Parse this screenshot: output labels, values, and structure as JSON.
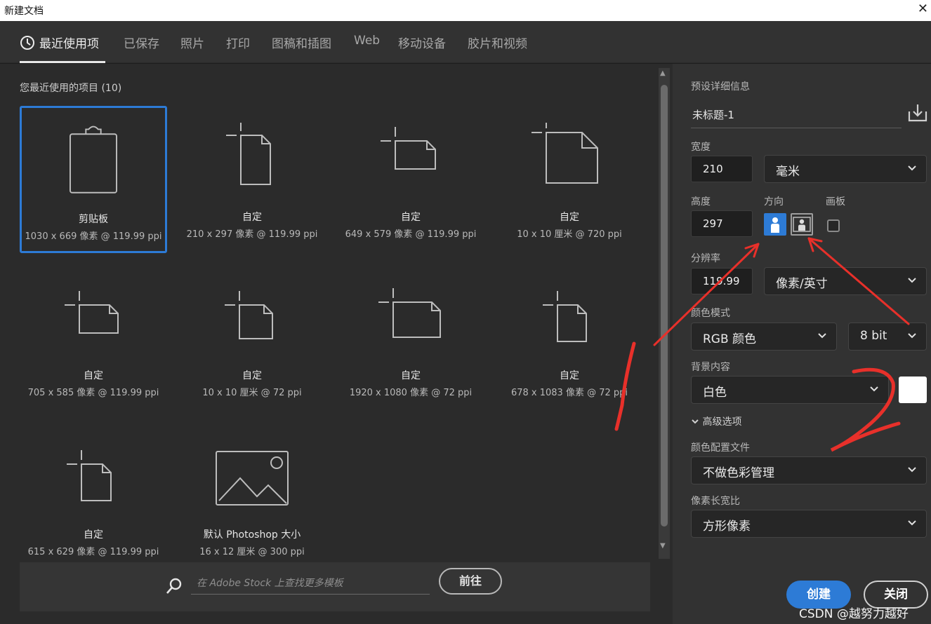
{
  "window": {
    "title": "新建文档",
    "close_glyph": "✕"
  },
  "tabs": [
    {
      "label": "最近使用项",
      "active": true
    },
    {
      "label": "已保存"
    },
    {
      "label": "照片"
    },
    {
      "label": "打印"
    },
    {
      "label": "图稿和插图"
    },
    {
      "label": "Web"
    },
    {
      "label": "移动设备"
    },
    {
      "label": "胶片和视频"
    }
  ],
  "recent": {
    "title": "您最近使用的项目",
    "count": "(10)",
    "items": [
      {
        "name": "剪贴板",
        "meta": "1030 x 669 像素 @ 119.99 ppi",
        "icon": "clipboard-icon",
        "selected": true
      },
      {
        "name": "自定",
        "meta": "210 x 297 像素 @ 119.99 ppi",
        "icon": "portrait-doc-icon"
      },
      {
        "name": "自定",
        "meta": "649 x 579 像素 @ 119.99 ppi",
        "icon": "landscape-doc-icon"
      },
      {
        "name": "自定",
        "meta": "10 x 10 厘米 @ 720 ppi",
        "icon": "square-doc-icon"
      },
      {
        "name": "自定",
        "meta": "705 x 585 像素 @ 119.99 ppi",
        "icon": "landscape-doc-icon"
      },
      {
        "name": "自定",
        "meta": "10 x 10 厘米 @ 72 ppi",
        "icon": "portrait-doc-icon"
      },
      {
        "name": "自定",
        "meta": "1920 x 1080 像素 @ 72 ppi",
        "icon": "landscape-doc-icon"
      },
      {
        "name": "自定",
        "meta": "678 x 1083 像素 @ 72 ppi",
        "icon": "portrait-doc-icon"
      },
      {
        "name": "自定",
        "meta": "615 x 629 像素 @ 119.99 ppi",
        "icon": "portrait-doc-icon"
      },
      {
        "name": "默认 Photoshop 大小",
        "meta": "16 x 12 厘米 @ 300 ppi",
        "icon": "image-icon"
      }
    ]
  },
  "stock": {
    "placeholder": "在 Adobe Stock 上查找更多模板",
    "go_label": "前往"
  },
  "preset": {
    "header": "预设详细信息",
    "doc_name": "未标题-1",
    "width_label": "宽度",
    "width_value": "210",
    "width_unit": "毫米",
    "height_label": "高度",
    "height_value": "297",
    "orientation_label": "方向",
    "orientation": "portrait",
    "artboard_label": "画板",
    "artboard_checked": false,
    "resolution_label": "分辨率",
    "resolution_value": "119.99",
    "resolution_unit": "像素/英寸",
    "color_mode_label": "颜色模式",
    "color_mode": "RGB 颜色",
    "bit_depth": "8 bit",
    "background_label": "背景内容",
    "background": "白色",
    "background_color": "#ffffff",
    "advanced_label": "高级选项",
    "color_profile_label": "颜色配置文件",
    "color_profile": "不做色彩管理",
    "pixel_aspect_label": "像素长宽比",
    "pixel_aspect": "方形像素"
  },
  "buttons": {
    "create": "创建",
    "close": "关闭"
  },
  "watermark": "CSDN @越努力越好",
  "colors": {
    "accent": "#2d7bd6",
    "annotation": "#e8302a"
  }
}
